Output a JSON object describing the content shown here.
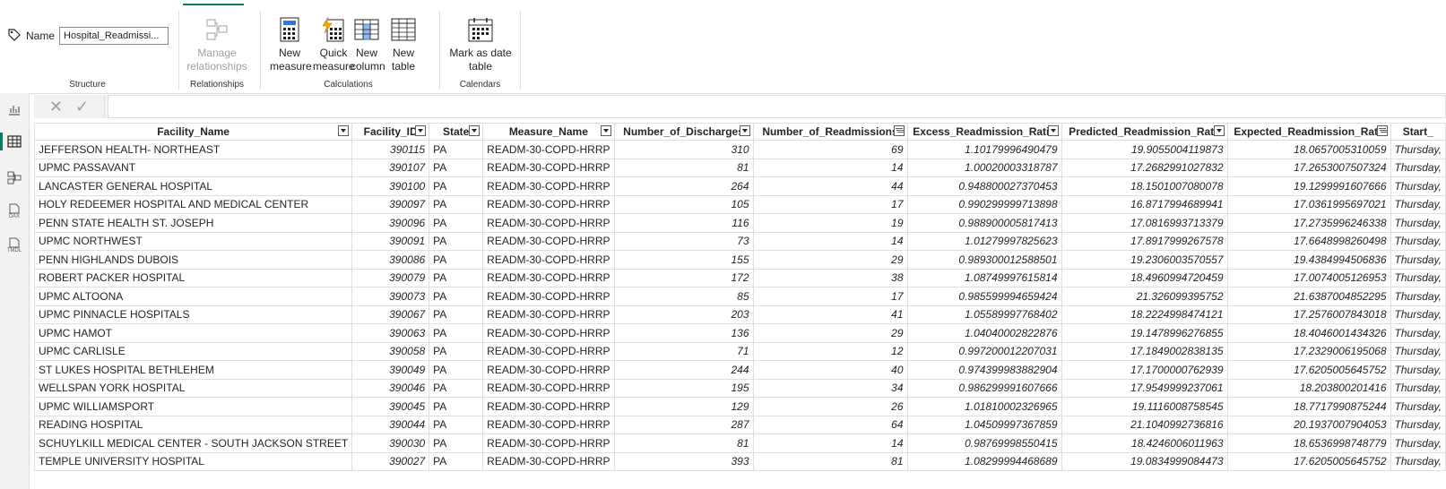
{
  "ribbon": {
    "name_label": "Name",
    "name_value": "Hospital_Readmissi...",
    "groups": {
      "structure": "Structure",
      "relationships": "Relationships",
      "calculations": "Calculations",
      "calendars": "Calendars"
    },
    "buttons": {
      "manage_relationships": [
        "Manage",
        "relationships"
      ],
      "new_measure": [
        "New",
        "measure"
      ],
      "quick_measure": [
        "Quick",
        "measure"
      ],
      "new_column": [
        "New",
        "column"
      ],
      "new_table": [
        "New",
        "table"
      ],
      "mark_as_date_table": [
        "Mark as date",
        "table"
      ]
    }
  },
  "rail": {
    "icons": [
      "report-view-icon",
      "table-view-icon",
      "model-view-icon",
      "dax-query-view-icon",
      "tmdl-view-icon"
    ],
    "dax_label": "DAX",
    "tmdl_label": "TMDL"
  },
  "grid": {
    "columns": [
      "Facility_Name",
      "Facility_ID",
      "State",
      "Measure_Name",
      "Number_of_Discharges",
      "Number_of_Readmissions",
      "Excess_Readmission_Ratio",
      "Predicted_Readmission_Rate",
      "Expected_Readmission_Rate",
      "Start_"
    ],
    "rows": [
      [
        "JEFFERSON HEALTH- NORTHEAST",
        "390115",
        "PA",
        "READM-30-COPD-HRRP",
        "310",
        "69",
        "1.10179996490479",
        "19.9055004119873",
        "18.0657005310059",
        "Thursday,"
      ],
      [
        "UPMC PASSAVANT",
        "390107",
        "PA",
        "READM-30-COPD-HRRP",
        "81",
        "14",
        "1.00020003318787",
        "17.2682991027832",
        "17.2653007507324",
        "Thursday,"
      ],
      [
        "LANCASTER GENERAL HOSPITAL",
        "390100",
        "PA",
        "READM-30-COPD-HRRP",
        "264",
        "44",
        "0.948800027370453",
        "18.1501007080078",
        "19.1299991607666",
        "Thursday,"
      ],
      [
        "HOLY REDEEMER HOSPITAL AND MEDICAL CENTER",
        "390097",
        "PA",
        "READM-30-COPD-HRRP",
        "105",
        "17",
        "0.990299999713898",
        "16.8717994689941",
        "17.0361995697021",
        "Thursday,"
      ],
      [
        "PENN STATE HEALTH ST. JOSEPH",
        "390096",
        "PA",
        "READM-30-COPD-HRRP",
        "116",
        "19",
        "0.988900005817413",
        "17.0816993713379",
        "17.2735996246338",
        "Thursday,"
      ],
      [
        "UPMC NORTHWEST",
        "390091",
        "PA",
        "READM-30-COPD-HRRP",
        "73",
        "14",
        "1.01279997825623",
        "17.8917999267578",
        "17.6648998260498",
        "Thursday,"
      ],
      [
        "PENN HIGHLANDS DUBOIS",
        "390086",
        "PA",
        "READM-30-COPD-HRRP",
        "155",
        "29",
        "0.989300012588501",
        "19.2306003570557",
        "19.4384994506836",
        "Thursday,"
      ],
      [
        "ROBERT PACKER HOSPITAL",
        "390079",
        "PA",
        "READM-30-COPD-HRRP",
        "172",
        "38",
        "1.08749997615814",
        "18.4960994720459",
        "17.0074005126953",
        "Thursday,"
      ],
      [
        "UPMC ALTOONA",
        "390073",
        "PA",
        "READM-30-COPD-HRRP",
        "85",
        "17",
        "0.985599994659424",
        "21.326099395752",
        "21.6387004852295",
        "Thursday,"
      ],
      [
        "UPMC PINNACLE HOSPITALS",
        "390067",
        "PA",
        "READM-30-COPD-HRRP",
        "203",
        "41",
        "1.05589997768402",
        "18.2224998474121",
        "17.2576007843018",
        "Thursday,"
      ],
      [
        "UPMC HAMOT",
        "390063",
        "PA",
        "READM-30-COPD-HRRP",
        "136",
        "29",
        "1.04040002822876",
        "19.1478996276855",
        "18.4046001434326",
        "Thursday,"
      ],
      [
        "UPMC CARLISLE",
        "390058",
        "PA",
        "READM-30-COPD-HRRP",
        "71",
        "12",
        "0.997200012207031",
        "17.1849002838135",
        "17.2329006195068",
        "Thursday,"
      ],
      [
        "ST LUKES HOSPITAL BETHLEHEM",
        "390049",
        "PA",
        "READM-30-COPD-HRRP",
        "244",
        "40",
        "0.974399983882904",
        "17.1700000762939",
        "17.6205005645752",
        "Thursday,"
      ],
      [
        "WELLSPAN YORK HOSPITAL",
        "390046",
        "PA",
        "READM-30-COPD-HRRP",
        "195",
        "34",
        "0.986299991607666",
        "17.9549999237061",
        "18.203800201416",
        "Thursday,"
      ],
      [
        "UPMC WILLIAMSPORT",
        "390045",
        "PA",
        "READM-30-COPD-HRRP",
        "129",
        "26",
        "1.01810002326965",
        "19.1116008758545",
        "18.7717990875244",
        "Thursday,"
      ],
      [
        "READING HOSPITAL",
        "390044",
        "PA",
        "READM-30-COPD-HRRP",
        "287",
        "64",
        "1.04509997367859",
        "21.1040992736816",
        "20.1937007904053",
        "Thursday,"
      ],
      [
        "SCHUYLKILL MEDICAL CENTER - SOUTH JACKSON STREET",
        "390030",
        "PA",
        "READM-30-COPD-HRRP",
        "81",
        "14",
        "0.98769998550415",
        "18.4246006011963",
        "18.6536998748779",
        "Thursday,"
      ],
      [
        "TEMPLE UNIVERSITY HOSPITAL",
        "390027",
        "PA",
        "READM-30-COPD-HRRP",
        "393",
        "81",
        "1.08299994468689",
        "19.0834999084473",
        "17.6205005645752",
        "Thursday,"
      ]
    ]
  }
}
